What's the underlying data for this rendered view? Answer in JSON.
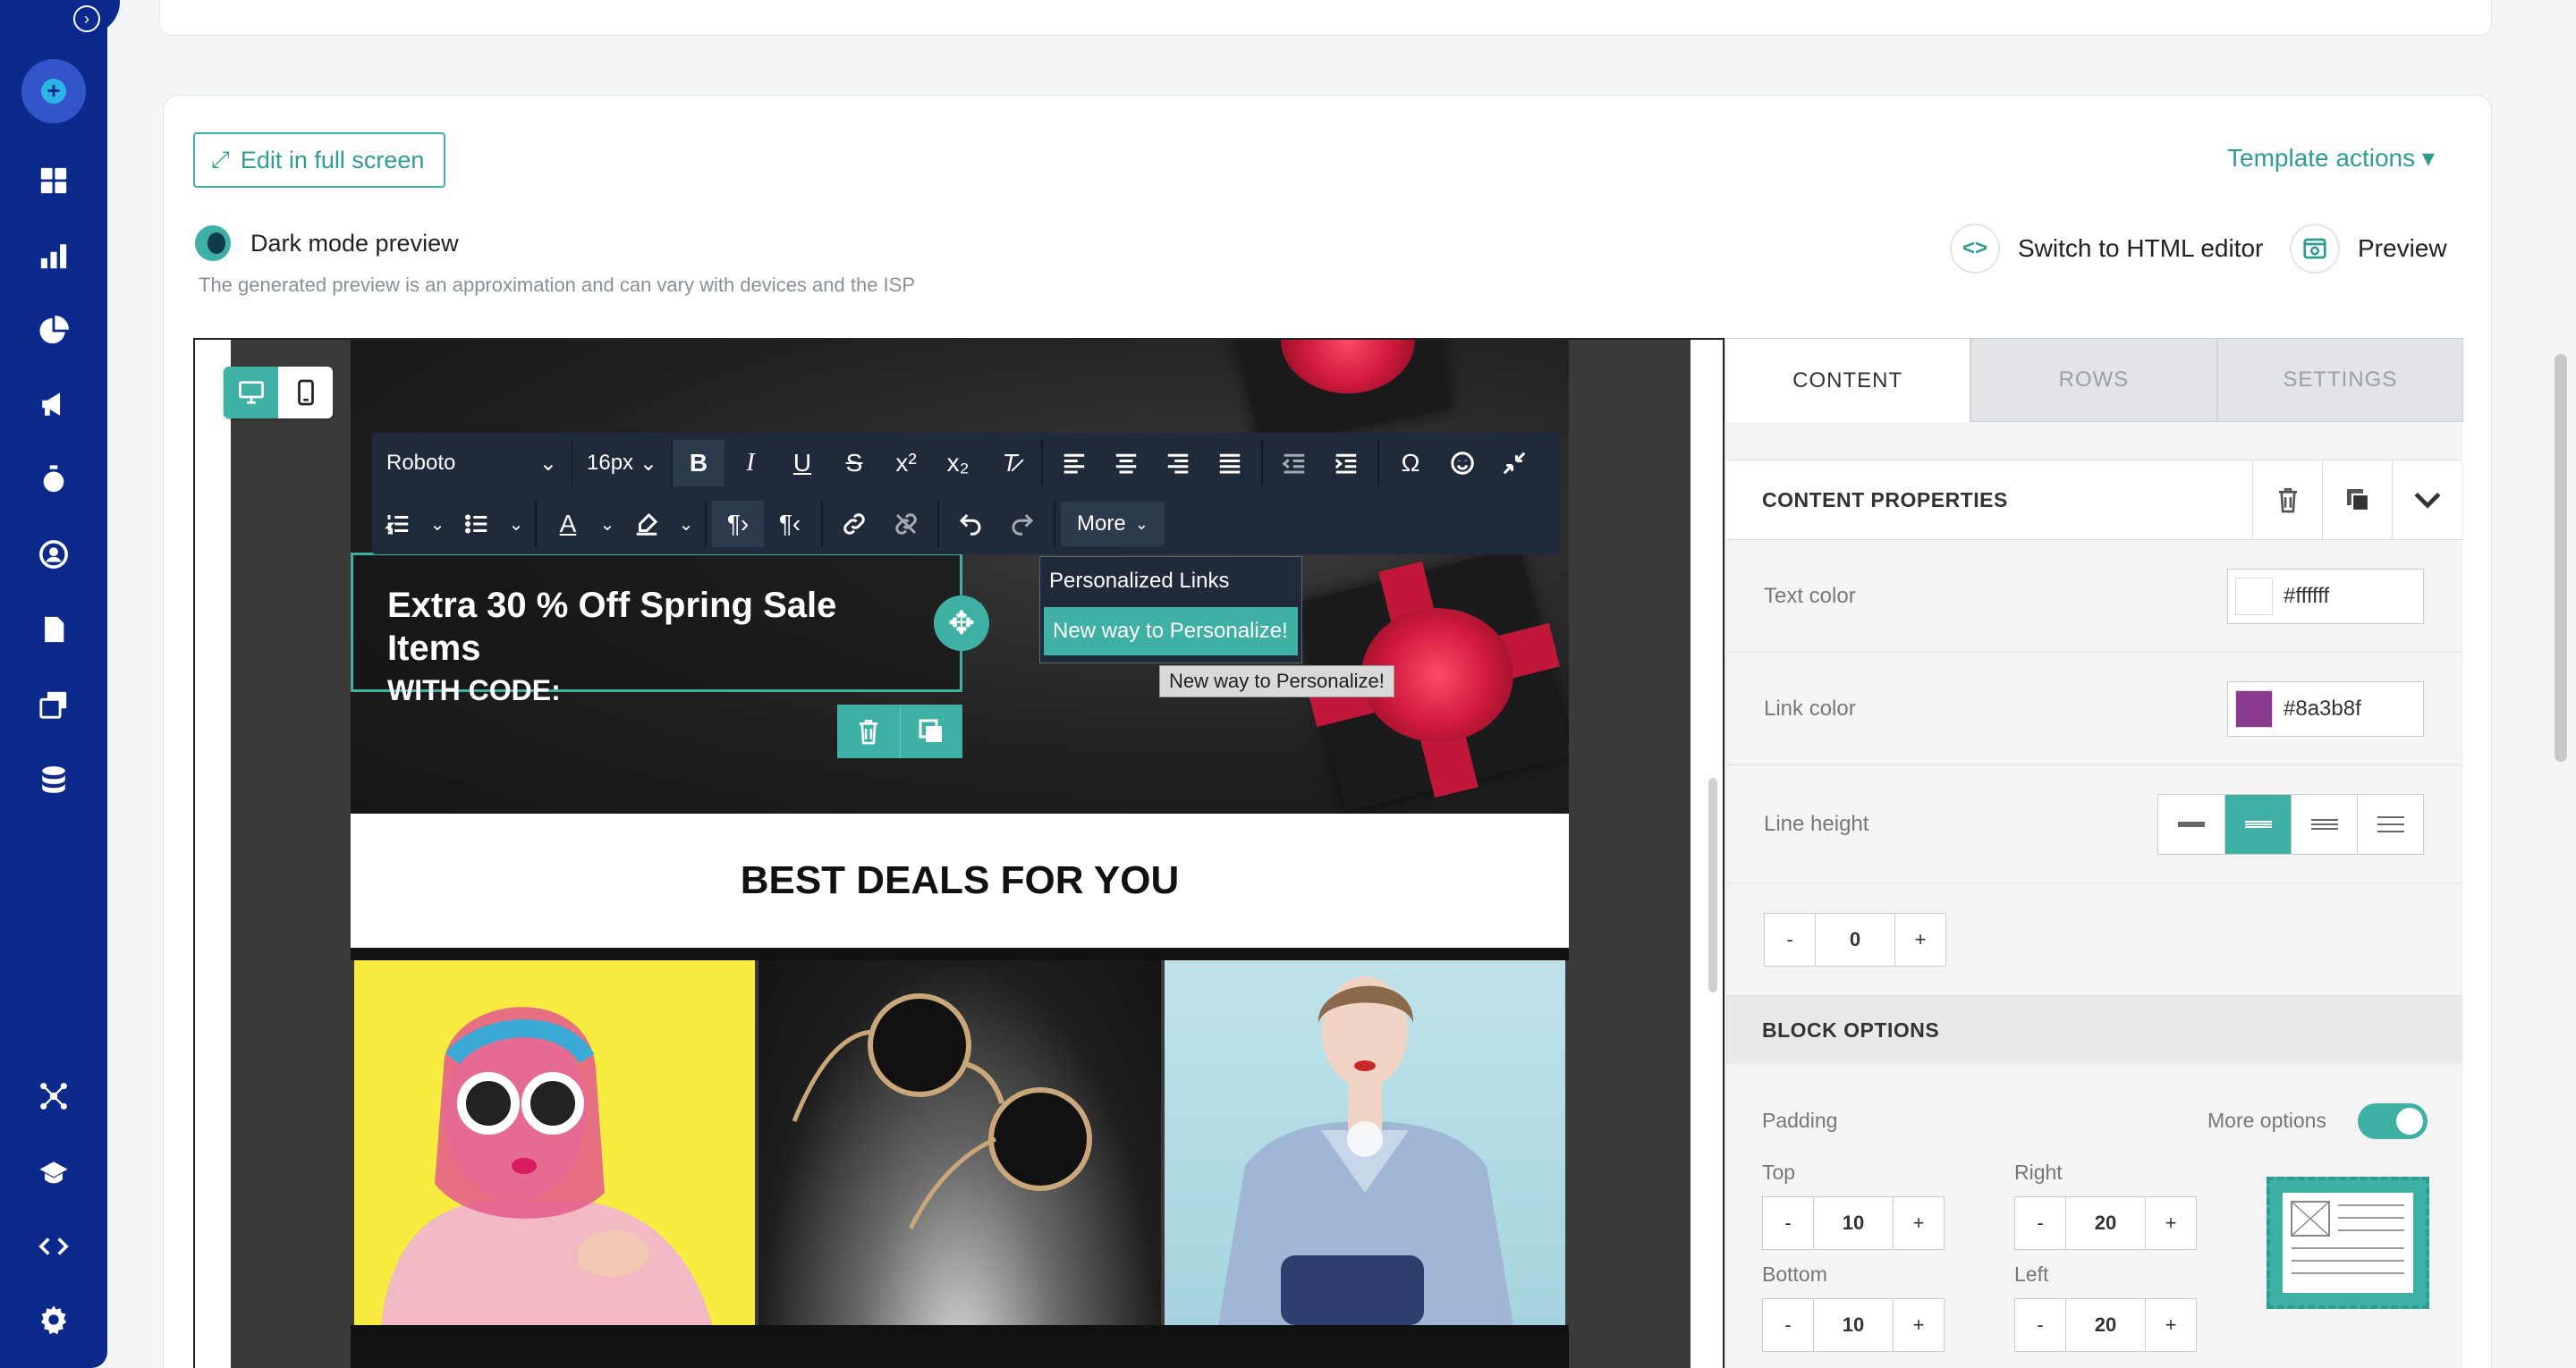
{
  "nav": {
    "icons": [
      "expand-icon",
      "add-icon",
      "dashboard-icon",
      "stats-icon",
      "pie-chart-icon",
      "megaphone-icon",
      "stopwatch-icon",
      "contacts-icon",
      "document-icon",
      "templates-icon",
      "database-icon",
      "integrations-icon",
      "academy-icon",
      "code-icon",
      "settings-icon"
    ]
  },
  "editor": {
    "fullscreen_label": "Edit in full screen",
    "template_actions_label": "Template actions ▾",
    "dark_mode_label": "Dark mode preview",
    "preview_note": "The generated preview is an approximation and can vary with devices and the ISP",
    "html_editor_label": "Switch to HTML editor",
    "preview_label": "Preview"
  },
  "toolbar": {
    "font": "Roboto",
    "size": "16px",
    "more_label": "More"
  },
  "dropdown": {
    "items": [
      "Personalized Links",
      "New way to Personalize!"
    ],
    "tooltip": "New way to Personalize!"
  },
  "email": {
    "headline": "Extra 30 % Off Spring Sale Items",
    "subheadline": "WITH CODE:",
    "deals_title": "BEST DEALS FOR YOU"
  },
  "panel": {
    "tabs": [
      "CONTENT",
      "ROWS",
      "SETTINGS"
    ],
    "content_properties": "CONTENT PROPERTIES",
    "text_color_label": "Text color",
    "text_color": "#ffffff",
    "link_color_label": "Link color",
    "link_color": "#8a3b8f",
    "line_height_label": "Line height",
    "letter_spacing_value": "0",
    "block_options": "BLOCK OPTIONS",
    "padding_label": "Padding",
    "more_options_label": "More options",
    "top_label": "Top",
    "top_value": "10",
    "right_label": "Right",
    "right_value": "20",
    "bottom_label": "Bottom",
    "bottom_value": "10",
    "left_label": "Left",
    "left_value": "20",
    "minus": "-",
    "plus": "+"
  },
  "colors": {
    "accent": "#3fb0a4",
    "nav": "#0b2a8c",
    "toolbar": "#1f2a3a"
  }
}
